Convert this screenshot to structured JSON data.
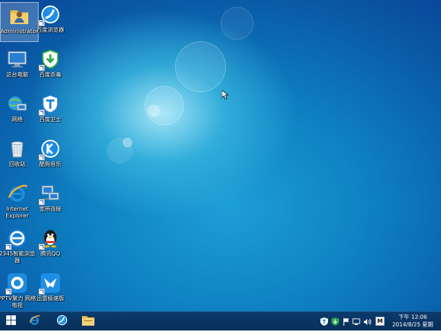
{
  "desktop": {
    "icons": [
      {
        "label": "Administrator",
        "icon": "user-folder-icon",
        "selected": true
      },
      {
        "label": "百度浏览器",
        "icon": "baidu-browser-icon"
      },
      {
        "label": "这台电脑",
        "icon": "computer-icon"
      },
      {
        "label": "百度杀毒",
        "icon": "baidu-antivirus-icon"
      },
      {
        "label": "网络",
        "icon": "network-icon"
      },
      {
        "label": "百度卫士",
        "icon": "baidu-guard-icon"
      },
      {
        "label": "回收站",
        "icon": "recycle-bin-icon"
      },
      {
        "label": "酷狗音乐",
        "icon": "kugou-icon"
      },
      {
        "label": "Internet Explorer",
        "icon": "internet-explorer-icon"
      },
      {
        "label": "宽带连接",
        "icon": "broadband-connection-icon"
      },
      {
        "label": "2345智能浏览器",
        "icon": "2345-browser-icon"
      },
      {
        "label": "腾讯QQ",
        "icon": "qq-icon"
      },
      {
        "label": "PPTV聚力 网络电视",
        "icon": "pptv-icon"
      },
      {
        "label": "迅雷极速版",
        "icon": "xunlei-icon"
      }
    ]
  },
  "taskbar": {
    "start": "windows-start-icon",
    "pinned": [
      "internet-explorer-icon",
      "baidu-browser-icon",
      "file-explorer-icon"
    ],
    "tray": {
      "ime_label": "M",
      "time": "下午 12:06",
      "date": "2014/8/25 星期一"
    }
  },
  "colors": {
    "taskbar": "#08305a",
    "desktop_bg": "#0d7ec0"
  }
}
